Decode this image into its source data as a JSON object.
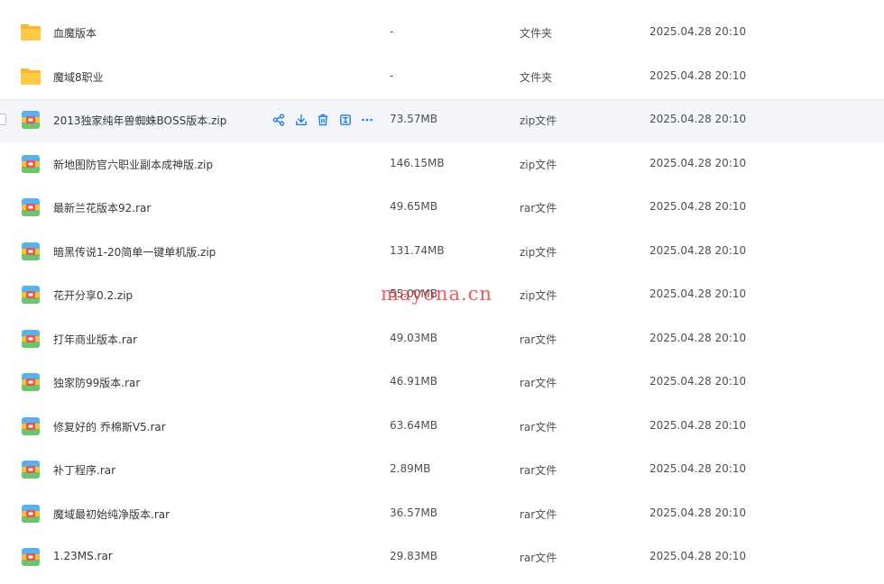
{
  "colors": {
    "folder_yellow": "#f7c23c",
    "archive_icon_colors": [
      "#5ab1f0",
      "#f3c13a",
      "#e8574b",
      "#6cc46d"
    ],
    "action_icon_blue": "#1f7ef2",
    "watermark": "#e82424",
    "hover_row_bg": "#f3f5f9"
  },
  "files": [
    {
      "name": "血魔版本",
      "size": "-",
      "type": "文件夹",
      "date": "2025.04.28 20:10",
      "icon": "folder-icon"
    },
    {
      "name": "魔域8职业",
      "size": "-",
      "type": "文件夹",
      "date": "2025.04.28 20:10",
      "icon": "folder-icon"
    },
    {
      "name": "2013独家纯年兽蜘蛛BOSS版本.zip",
      "size": "73.57MB",
      "type": "zip文件",
      "date": "2025.04.28 20:10",
      "icon": "archive-icon"
    },
    {
      "name": "新地图防官六职业副本成神版.zip",
      "size": "146.15MB",
      "type": "zip文件",
      "date": "2025.04.28 20:10",
      "icon": "archive-icon"
    },
    {
      "name": "最新兰花版本92.rar",
      "size": "49.65MB",
      "type": "rar文件",
      "date": "2025.04.28 20:10",
      "icon": "archive-icon"
    },
    {
      "name": "暗黑传说1-20简单一键单机版.zip",
      "size": "131.74MB",
      "type": "zip文件",
      "date": "2025.04.28 20:10",
      "icon": "archive-icon"
    },
    {
      "name": "花开分享0.2.zip",
      "size": "55.00MB",
      "type": "zip文件",
      "date": "2025.04.28 20:10",
      "icon": "archive-icon"
    },
    {
      "name": "打年商业版本.rar",
      "size": "49.03MB",
      "type": "rar文件",
      "date": "2025.04.28 20:10",
      "icon": "archive-icon"
    },
    {
      "name": "独家防99版本.rar",
      "size": "46.91MB",
      "type": "rar文件",
      "date": "2025.04.28 20:10",
      "icon": "archive-icon"
    },
    {
      "name": "修复好的 乔棉斯V5.rar",
      "size": "63.64MB",
      "type": "rar文件",
      "date": "2025.04.28 20:10",
      "icon": "archive-icon"
    },
    {
      "name": "补丁程序.rar",
      "size": "2.89MB",
      "type": "rar文件",
      "date": "2025.04.28 20:10",
      "icon": "archive-icon"
    },
    {
      "name": "魔域最初始纯净版本.rar",
      "size": "36.57MB",
      "type": "rar文件",
      "date": "2025.04.28 20:10",
      "icon": "archive-icon"
    },
    {
      "name": "1.23MS.rar",
      "size": "29.83MB",
      "type": "rar文件",
      "date": "2025.04.28 20:10",
      "icon": "archive-icon"
    }
  ],
  "hovered_row_actions": [
    "share-icon",
    "download-icon",
    "delete-icon",
    "rename-icon",
    "more-icon"
  ],
  "watermark": "mayona.cn"
}
